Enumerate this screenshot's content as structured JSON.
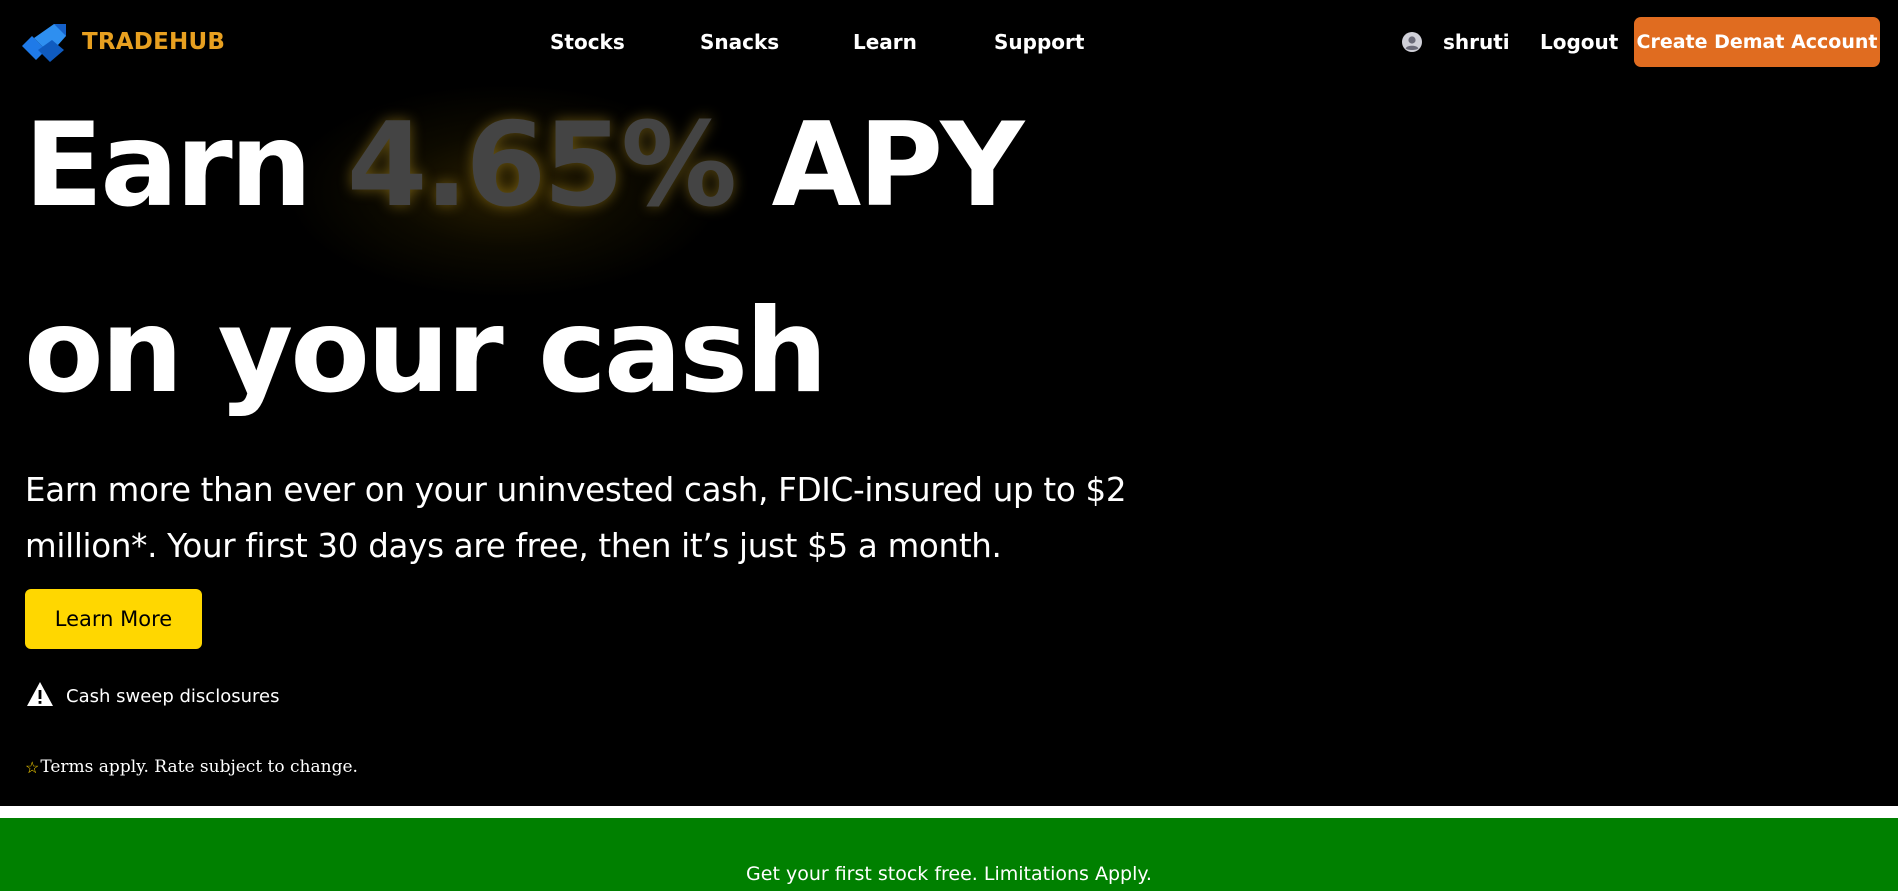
{
  "brand": {
    "name": "TRADEHUB",
    "logo_icon": "tradehub-arrow-logo",
    "color": "#e8a020"
  },
  "nav": {
    "items": [
      {
        "label": "Stocks"
      },
      {
        "label": "Snacks"
      },
      {
        "label": "Learn"
      },
      {
        "label": "Support"
      }
    ]
  },
  "user": {
    "icon": "user-avatar-icon",
    "name": "shruti",
    "logout_label": "Logout"
  },
  "cta": {
    "label": "Create Demat Account",
    "color": "#e06c20"
  },
  "hero": {
    "headline_prefix": "Earn",
    "rate": "4.65%",
    "headline_suffix": "APY",
    "headline_line2": "on your cash",
    "subtext": "Earn more than ever on your uninvested cash, FDIC-insured up to $2 million*. Your first 30 days are free, then it’s just $5 a month.",
    "button_label": "Learn More",
    "button_color": "#ffd700",
    "disclosure_label": "Cash sweep disclosures",
    "disclosure_icon": "warning-icon",
    "terms_icon": "star-icon",
    "terms": "Terms apply. Rate subject to change."
  },
  "promo": {
    "text": "Get your first stock free. Limitations Apply.",
    "color": "#008000"
  }
}
